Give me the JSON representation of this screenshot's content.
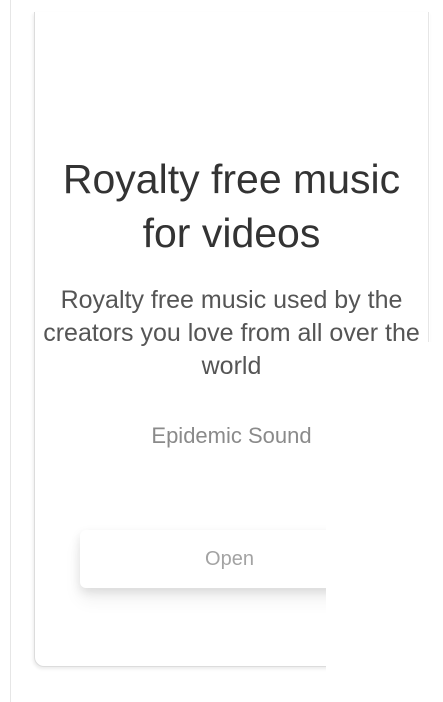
{
  "promo": {
    "headline": "Royalty free music for videos",
    "description": "Royalty free music used by the creators you love from all over the world",
    "app_name": "Epidemic Sound",
    "open_label": "Open"
  }
}
